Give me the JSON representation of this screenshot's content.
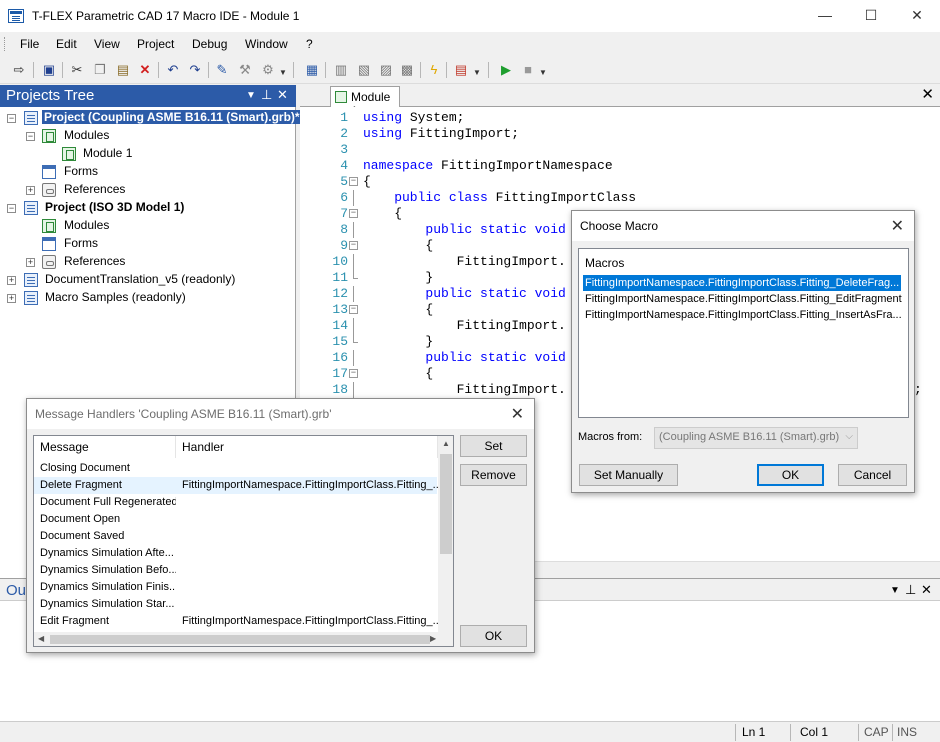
{
  "window": {
    "title": "T-FLEX Parametric CAD 17 Macro IDE - Module 1",
    "controls": {
      "minimize": "—",
      "maximize": "☐",
      "close": "✕"
    }
  },
  "menu": [
    "File",
    "Edit",
    "View",
    "Project",
    "Debug",
    "Window",
    "?"
  ],
  "toolbar_icons": [
    "login-icon",
    "save-icon",
    "cut-icon",
    "copy-icon",
    "paste-icon",
    "delete-icon",
    "undo-icon",
    "redo-icon",
    "brush-icon",
    "wrench-icon",
    "tools-icon",
    "new-form-icon",
    "module-icon",
    "module-copy-icon",
    "module-add-icon",
    "module-key-icon",
    "lightning-icon",
    "message-icon",
    "run-icon",
    "stop-icon"
  ],
  "projects_tree": {
    "title": "Projects Tree",
    "controls": {
      "dropdown": "▼",
      "pin": "⊥",
      "close": "✕"
    },
    "items": [
      {
        "label": "Project (Coupling ASME B16.11 (Smart).grb)*"
      },
      {
        "label": "Modules"
      },
      {
        "label": "Module 1"
      },
      {
        "label": "Forms"
      },
      {
        "label": "References"
      },
      {
        "label": "Project (ISO 3D Model 1)"
      },
      {
        "label": "Modules"
      },
      {
        "label": "Forms"
      },
      {
        "label": "References"
      },
      {
        "label": "DocumentTranslation_v5 (readonly)"
      },
      {
        "label": "Macro Samples (readonly)"
      }
    ]
  },
  "editor": {
    "tab": "Module 1",
    "close": "✕",
    "lines": [
      {
        "n": "1",
        "kw": "using",
        "rest": " System;"
      },
      {
        "n": "2",
        "kw": "using",
        "rest": " FittingImport;"
      },
      {
        "n": "3",
        "kw": "",
        "rest": ""
      },
      {
        "n": "4",
        "kw": "namespace",
        "rest": " FittingImportNamespace"
      },
      {
        "n": "5",
        "kw": "",
        "rest": "{"
      },
      {
        "n": "6",
        "kw": "    public class",
        "rest": " FittingImportClass"
      },
      {
        "n": "7",
        "kw": "",
        "rest": "    {"
      },
      {
        "n": "8",
        "kw": "        public static void",
        "rest": ""
      },
      {
        "n": "9",
        "kw": "",
        "rest": "        {"
      },
      {
        "n": "10",
        "kw": "",
        "rest": "            FittingImport."
      },
      {
        "n": "11",
        "kw": "",
        "rest": "        }"
      },
      {
        "n": "12",
        "kw": "        public static void",
        "rest": ""
      },
      {
        "n": "13",
        "kw": "",
        "rest": "        {"
      },
      {
        "n": "14",
        "kw": "",
        "rest": "            FittingImport."
      },
      {
        "n": "15",
        "kw": "",
        "rest": "        }"
      },
      {
        "n": "16",
        "kw": "        public static void",
        "rest": ""
      },
      {
        "n": "17",
        "kw": "",
        "rest": "        {"
      },
      {
        "n": "18",
        "kw": "",
        "rest": "            FittingImport."
      }
    ],
    "line18_tail": ";"
  },
  "output": {
    "title": "Ou",
    "controls": {
      "dropdown": "▼",
      "pin": "⊥",
      "close": "✕"
    }
  },
  "status": {
    "ln": "Ln 1",
    "col": "Col 1",
    "cap": "CAP",
    "ins": "INS"
  },
  "choose_macro": {
    "title": "Choose Macro",
    "close": "✕",
    "list_header": "Macros",
    "items": [
      "FittingImportNamespace.FittingImportClass.Fitting_DeleteFrag...",
      "FittingImportNamespace.FittingImportClass.Fitting_EditFragment",
      "FittingImportNamespace.FittingImportClass.Fitting_InsertAsFra..."
    ],
    "selected_index": 0,
    "macros_from_label": "Macros from:",
    "macros_from_value": "(Coupling ASME B16.11 (Smart).grb)",
    "buttons": {
      "set_manually": "Set Manually",
      "ok": "OK",
      "cancel": "Cancel"
    }
  },
  "message_handlers": {
    "title": "Message Handlers 'Coupling ASME B16.11 (Smart).grb'",
    "close": "✕",
    "columns": [
      "Message",
      "Handler"
    ],
    "rows": [
      {
        "message": "Closing Document",
        "handler": ""
      },
      {
        "message": "Delete Fragment",
        "handler": "FittingImportNamespace.FittingImportClass.Fitting_..."
      },
      {
        "message": "Document Full Regenerated",
        "handler": ""
      },
      {
        "message": "Document Open",
        "handler": ""
      },
      {
        "message": "Document Saved",
        "handler": ""
      },
      {
        "message": "Dynamics Simulation Afte...",
        "handler": ""
      },
      {
        "message": "Dynamics Simulation Befo...",
        "handler": ""
      },
      {
        "message": "Dynamics Simulation Finis...",
        "handler": ""
      },
      {
        "message": "Dynamics Simulation Star...",
        "handler": ""
      },
      {
        "message": "Edit Fragment",
        "handler": "FittingImportNamespace.FittingImportClass.Fitting_..."
      }
    ],
    "highlighted_index": 1,
    "buttons": {
      "set": "Set",
      "remove": "Remove",
      "ok": "OK"
    }
  }
}
